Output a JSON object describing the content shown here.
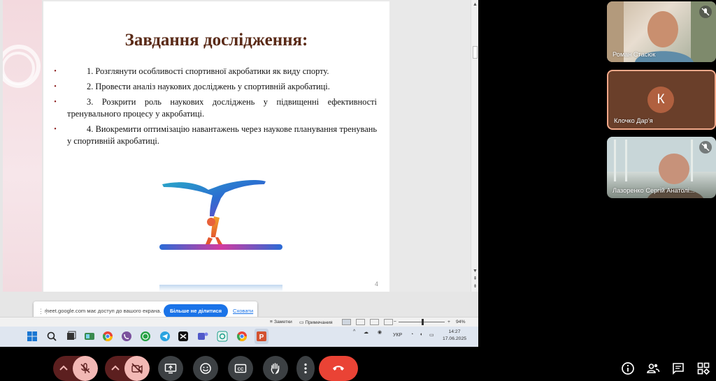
{
  "slide": {
    "title": "Завдання дослідження:",
    "bullets": [
      "1. Розглянути особливості спортивної акробатики як виду спорту.",
      "2. Провести аналіз наукових досліджень у спортивній акробатиці.",
      "3. Розкрити роль наукових досліджень у підвищенні ефективності тренувального процесу у акробатиці.",
      "4. Виокремити оптимізацію навантажень через наукове планування тренувань у спортивній акробатиці."
    ],
    "bullet_glyph": "•",
    "page_number": "4"
  },
  "share_bar": {
    "message": "meet.google.com має доступ до вашого екрана.",
    "stop_label": "Більше не ділитися",
    "hide_label": "Сховати"
  },
  "statusbar": {
    "notes_label": "Заметки",
    "comments_label": "Примечания",
    "zoom": "94%"
  },
  "taskbar": {
    "language": "УКР",
    "time": "14:27",
    "date": "17.06.2025"
  },
  "participants": [
    {
      "name": "Роман Стасюк",
      "muted": true
    },
    {
      "name": "Клочко Дар’я",
      "initial": "К",
      "muted": false
    },
    {
      "name": "Лазоренко Сергій Анатолі...",
      "muted": true
    }
  ],
  "controls": {
    "mic": "muted",
    "camera": "off",
    "icons": [
      "present-icon",
      "emoji-icon",
      "captions-icon",
      "raise-hand-icon",
      "more-icon",
      "end-call-icon"
    ],
    "right_icons": [
      "info-icon",
      "people-icon",
      "chat-icon",
      "activities-icon"
    ]
  },
  "colors": {
    "title": "#5a2a17",
    "bullet": "#8b1a1a",
    "stop_button": "#1a73e8",
    "end_call": "#ea4335",
    "muted_pair_bg": "#5c1f1f",
    "muted_pair_fg": "#f2b8b5",
    "active_speaker_border": "#f2a98a"
  }
}
